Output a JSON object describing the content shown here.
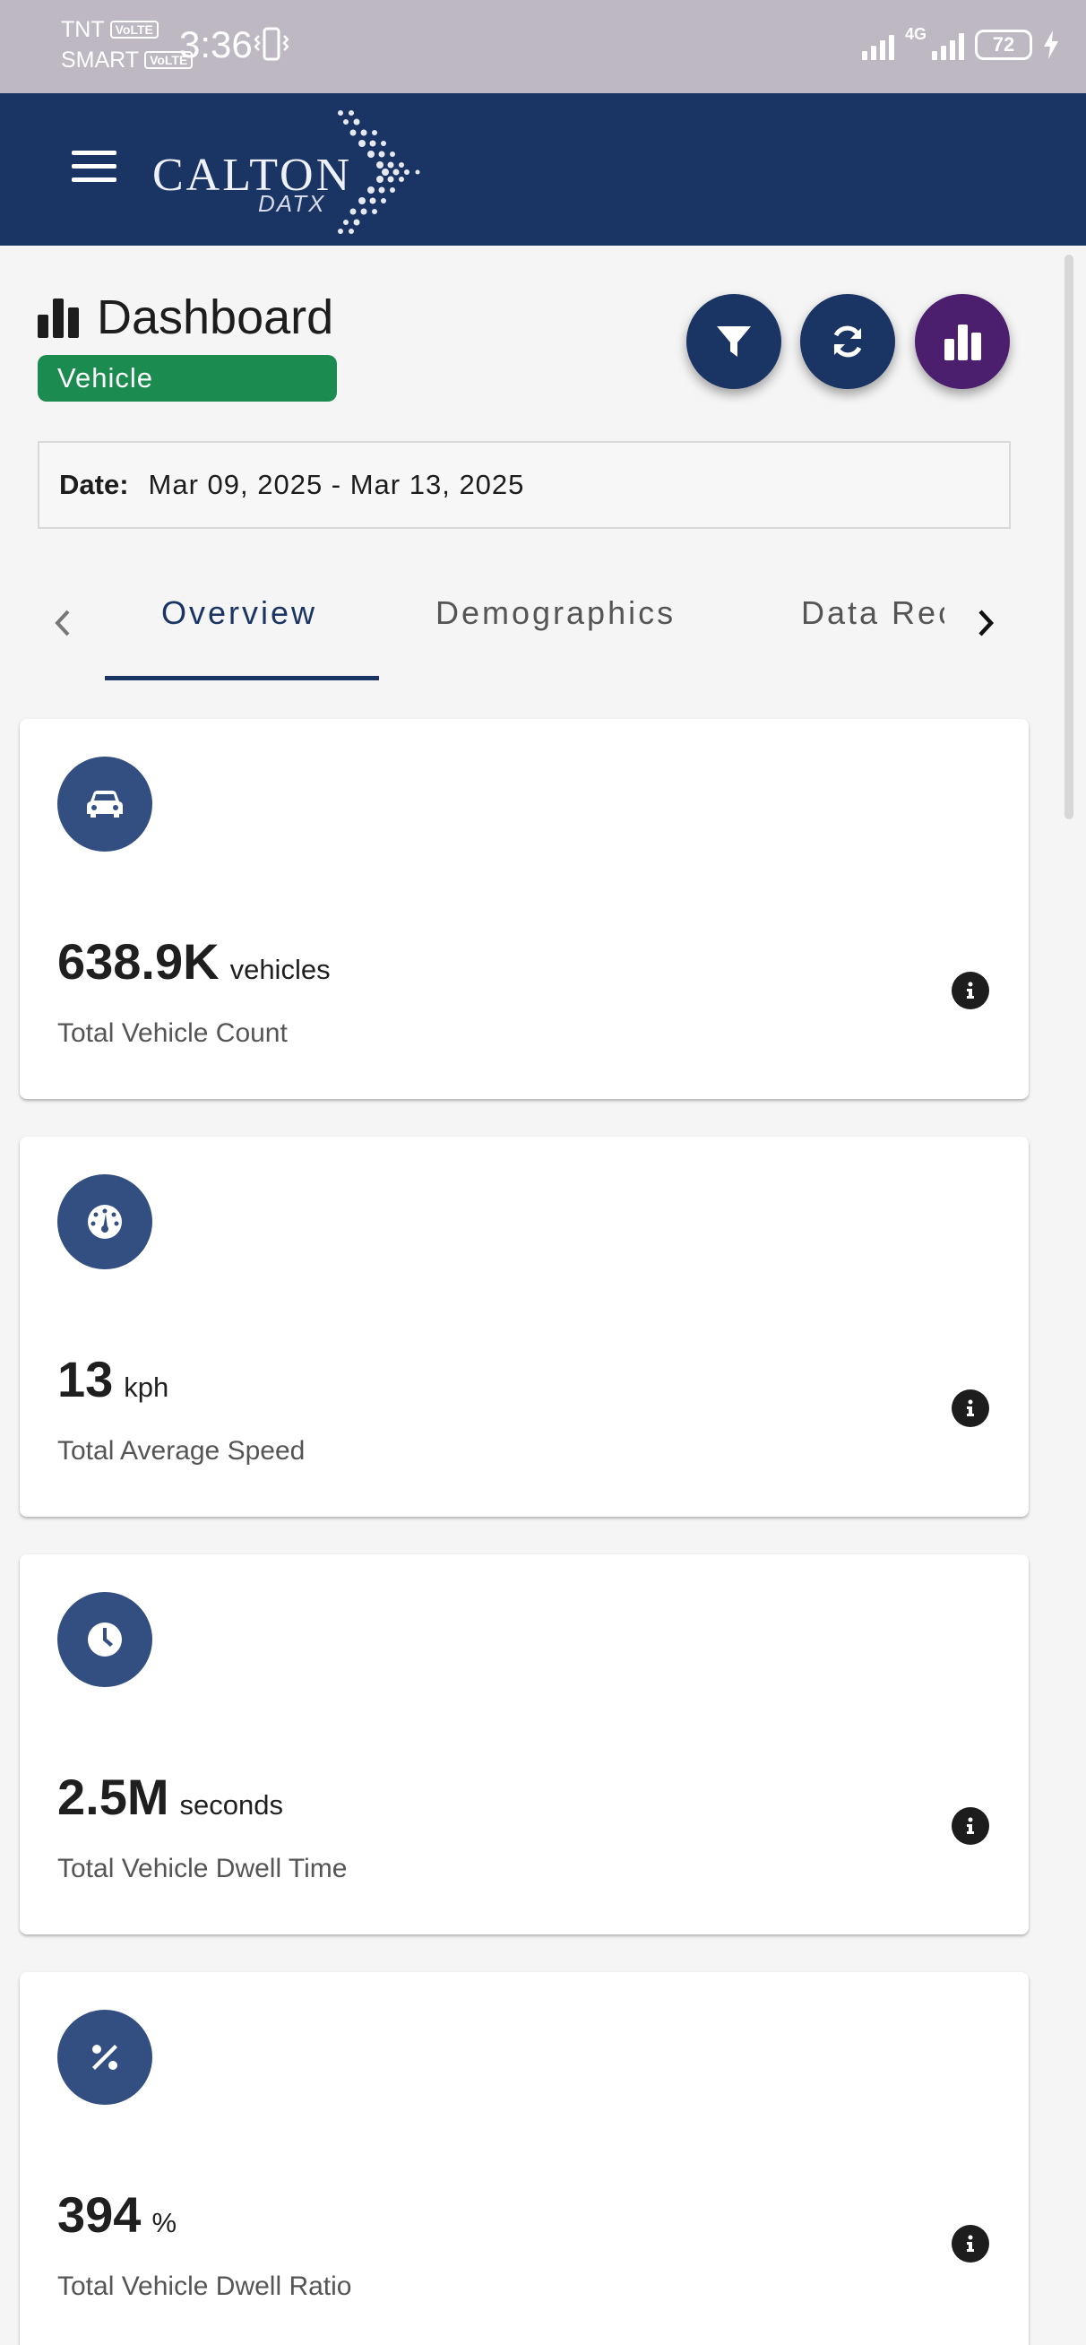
{
  "status_bar": {
    "carrier_1": "TNT",
    "carrier_2": "SMART",
    "volte": "VoLTE",
    "time": "3:36",
    "network": "4G",
    "battery": "72"
  },
  "header": {
    "logo_main": "CALTON",
    "logo_sub": "DATX"
  },
  "dashboard": {
    "title": "Dashboard",
    "badge": "Vehicle",
    "date_label": "Date:",
    "date_value": "Mar 09, 2025 - Mar 13, 2025"
  },
  "tabs": [
    {
      "label": "Overview",
      "active": true
    },
    {
      "label": "Demographics",
      "active": false
    },
    {
      "label": "Data Records",
      "active": false
    }
  ],
  "cards": [
    {
      "icon": "car-icon",
      "value": "638.9K",
      "unit": "vehicles",
      "label": "Total Vehicle Count"
    },
    {
      "icon": "speedometer-icon",
      "value": "13",
      "unit": "kph",
      "label": "Total Average Speed"
    },
    {
      "icon": "clock-icon",
      "value": "2.5M",
      "unit": "seconds",
      "label": "Total Vehicle Dwell Time"
    },
    {
      "icon": "percent-icon",
      "value": "394",
      "unit": "%",
      "label": "Total Vehicle Dwell Ratio"
    }
  ],
  "colors": {
    "header_bg": "#1a3464",
    "badge_green": "#1c8b50",
    "card_icon_bg": "#334f82",
    "chart_fab": "#4b1f6e",
    "status_bar_bg": "#bdb8c1"
  }
}
